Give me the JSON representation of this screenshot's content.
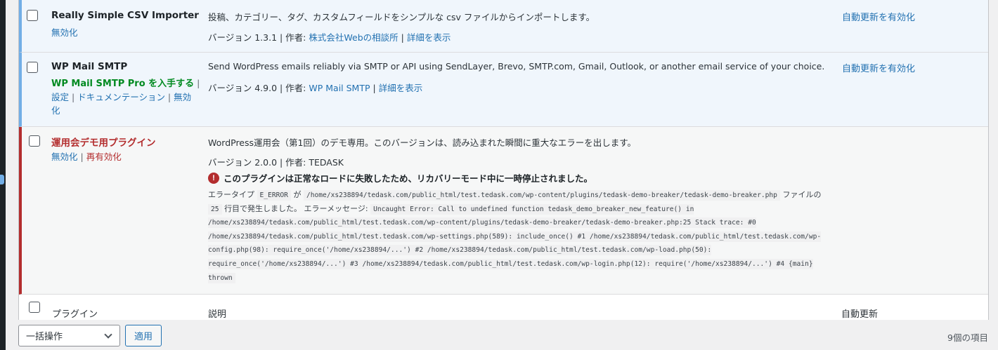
{
  "plugins": [
    {
      "name": "Really Simple CSV Importer",
      "action_deactivate": "無効化",
      "description": "投稿、カテゴリー、タグ、カスタムフィールドをシンプルな csv ファイルからインポートします。",
      "version_label": "バージョン 1.3.1 | 作者: ",
      "author": "株式会社Webの相談所",
      "sep": " | ",
      "details": "詳細を表示",
      "auto_update": "自動更新を有効化"
    },
    {
      "name": "WP Mail SMTP",
      "action_pro": "WP Mail SMTP Pro を入手する",
      "action_settings": "設定",
      "action_docs": "ドキュメンテーション",
      "action_deactivate": "無効",
      "action_deactivate_tail": "化",
      "description": "Send WordPress emails reliably via SMTP or API using SendLayer, Brevo, SMTP.com, Gmail, Outlook, or another email service of your choice.",
      "version_label": "バージョン 4.9.0 | 作者: ",
      "author": "WP Mail SMTP",
      "sep": " | ",
      "details": "詳細を表示",
      "auto_update": "自動更新を有効化"
    },
    {
      "name": "運用会デモ用プラグイン",
      "action_deactivate": "無効化",
      "action_reactivate": "再有効化",
      "description": "WordPress運用会（第1回）のデモ専用。このバージョンは、読み込まれた瞬間に重大なエラーを出します。",
      "version_label": "バージョン 2.0.0 | 作者: TEDASK",
      "warning": "このプラグインは正常なロードに失敗したため、リカバリーモード中に一時停止されました。",
      "error": {
        "t1": "エラータイプ",
        "type": "E_ERROR",
        "t2": "が",
        "file": "/home/xs238894/tedask.com/public_html/test.tedask.com/wp-content/plugins/tedask-demo-breaker/tedask-demo-breaker.php",
        "t3": "ファイルの",
        "line": "25",
        "t4": "行目で発生しました。 エラーメッセージ:",
        "message": "Uncaught Error: Call to undefined function tedask_demo_breaker_new_feature() in /home/xs238894/tedask.com/public_html/test.tedask.com/wp-content/plugins/tedask-demo-breaker/tedask-demo-breaker.php:25 Stack trace: #0 /home/xs238894/tedask.com/public_html/test.tedask.com/wp-settings.php(589): include_once() #1 /home/xs238894/tedask.com/public_html/test.tedask.com/wp-config.php(98): require_once('/home/xs238894/...') #2 /home/xs238894/tedask.com/public_html/test.tedask.com/wp-load.php(50): require_once('/home/xs238894/...') #3 /home/xs238894/tedask.com/public_html/test.tedask.com/wp-login.php(12): require('/home/xs238894/...') #4 {main} thrown"
      }
    }
  ],
  "footer": {
    "col_plugin": "プラグイン",
    "col_description": "説明",
    "col_auto_update": "自動更新"
  },
  "bulk": {
    "select_label": "一括操作",
    "apply_label": "適用"
  },
  "item_count": "9個の項目",
  "colors": {
    "accent_blue": "#2271b1",
    "active_border": "#72aee6",
    "error_border": "#b32d2e",
    "pro_green": "#008a20"
  }
}
